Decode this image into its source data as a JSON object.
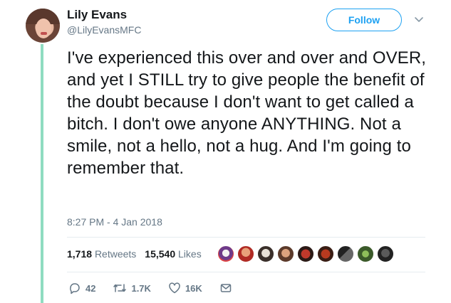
{
  "user": {
    "display_name": "Lily Evans",
    "handle": "@LilyEvansMFC"
  },
  "follow_label": "Follow",
  "tweet": {
    "text": "I've experienced this over and over and OVER, and yet I STILL try to give people the benefit of the doubt because I don't want to get called a bitch. I don't owe anyone ANYTHING. Not a smile, not a hello, not a hug. And I'm going to remember that.",
    "timestamp": "8:27 PM - 4 Jan 2018"
  },
  "stats": {
    "retweets_count": "1,718",
    "retweets_label": "Retweets",
    "likes_count": "15,540",
    "likes_label": "Likes"
  },
  "actions": {
    "replies": "42",
    "retweets": "1.7K",
    "likes": "16K"
  },
  "colors": {
    "accent": "#1da1f2",
    "thread_line": "#8fdcc0",
    "muted": "#657786"
  }
}
